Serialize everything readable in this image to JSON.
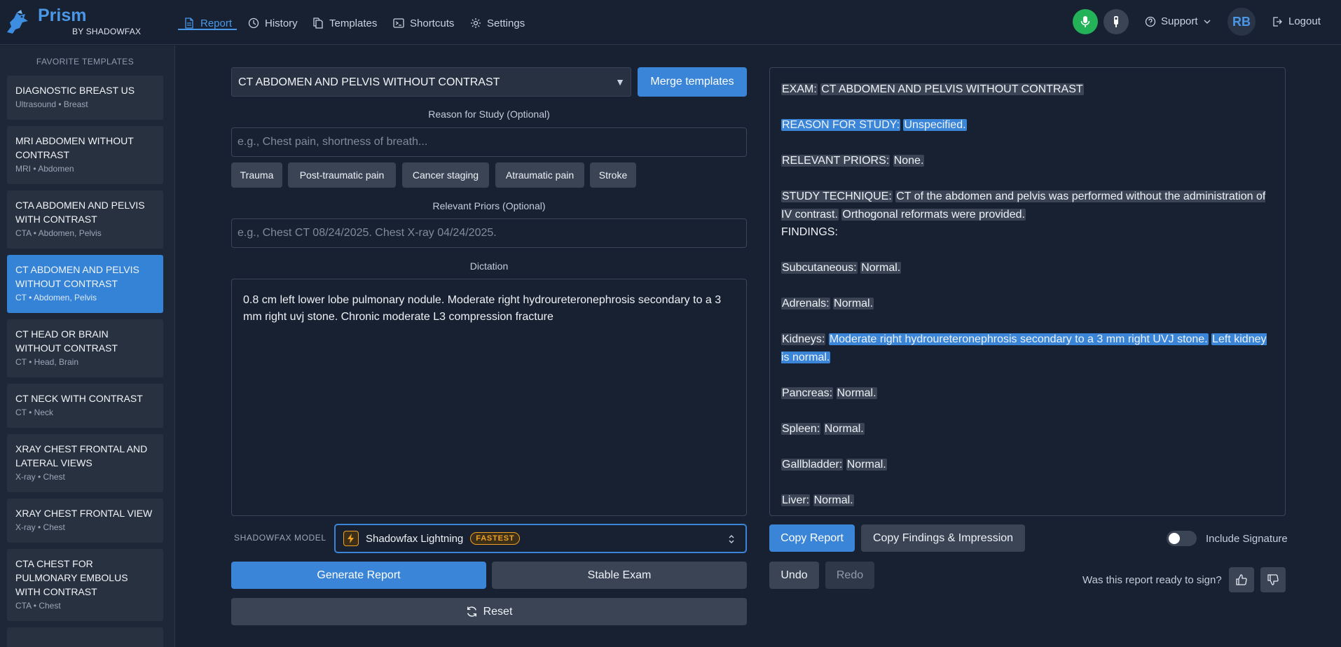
{
  "app": {
    "title": "Prism",
    "subtitle": "BY SHADOWFAX",
    "initials": "RB"
  },
  "nav": {
    "items": [
      {
        "label": "Report",
        "icon": "document-icon",
        "active": true
      },
      {
        "label": "History",
        "icon": "clock-icon"
      },
      {
        "label": "Templates",
        "icon": "copy-icon"
      },
      {
        "label": "Shortcuts",
        "icon": "terminal-icon"
      },
      {
        "label": "Settings",
        "icon": "gear-icon"
      }
    ],
    "support": "Support",
    "logout": "Logout"
  },
  "sidebar": {
    "heading": "FAVORITE TEMPLATES",
    "templates": [
      {
        "title": "DIAGNOSTIC BREAST US",
        "sub": "Ultrasound • Breast"
      },
      {
        "title": "MRI ABDOMEN WITHOUT CONTRAST",
        "sub": "MRI • Abdomen"
      },
      {
        "title": "CTA ABDOMEN AND PELVIS WITH CONTRAST",
        "sub": "CTA • Abdomen, Pelvis"
      },
      {
        "title": "CT ABDOMEN AND PELVIS WITHOUT CONTRAST",
        "sub": "CT • Abdomen, Pelvis",
        "active": true
      },
      {
        "title": "CT HEAD OR BRAIN WITHOUT CONTRAST",
        "sub": "CT • Head, Brain"
      },
      {
        "title": "CT NECK WITH CONTRAST",
        "sub": "CT • Neck"
      },
      {
        "title": "XRAY CHEST FRONTAL AND LATERAL VIEWS",
        "sub": "X-ray • Chest"
      },
      {
        "title": "XRAY CHEST FRONTAL VIEW",
        "sub": "X-ray • Chest"
      },
      {
        "title": "CTA CHEST FOR PULMONARY EMBOLUS WITH CONTRAST",
        "sub": "CTA • Chest"
      }
    ]
  },
  "form": {
    "selected_template": "CT ABDOMEN AND PELVIS WITHOUT CONTRAST",
    "merge_button": "Merge templates",
    "reason_label": "Reason for Study (Optional)",
    "reason_placeholder": "e.g., Chest pain, shortness of breath...",
    "chips": [
      "Trauma",
      "Post-traumatic pain",
      "Cancer staging",
      "Atraumatic pain",
      "Stroke"
    ],
    "priors_label": "Relevant Priors (Optional)",
    "priors_placeholder": "e.g., Chest CT 08/24/2025. Chest X-ray 04/24/2025.",
    "dictation_label": "Dictation",
    "dictation_text": "0.8 cm left lower lobe pulmonary nodule. Moderate right hydroureteronephrosis secondary to a 3 mm right uvj stone. Chronic moderate L3 compression fracture",
    "model_label": "SHADOWFAX MODEL",
    "model_name": "Shadowfax Lightning",
    "model_badge": "FASTEST",
    "generate": "Generate Report",
    "stable": "Stable Exam",
    "reset": "Reset"
  },
  "report": {
    "exam_label": "EXAM:",
    "exam_value": "CT ABDOMEN AND PELVIS WITHOUT CONTRAST",
    "reason_label": "REASON FOR STUDY:",
    "reason_value": "Unspecified.",
    "priors_label": "RELEVANT PRIORS:",
    "priors_value": "None.",
    "technique_label": "STUDY TECHNIQUE:",
    "technique_s1": "CT of the abdomen and pelvis was performed without the administration of IV contrast.",
    "technique_s2": "Orthogonal reformats were provided.",
    "findings_label": "FINDINGS:",
    "subcutaneous_label": "Subcutaneous:",
    "subcutaneous_value": "Normal.",
    "adrenals_label": "Adrenals:",
    "adrenals_value": "Normal.",
    "kidneys_label": "Kidneys:",
    "kidneys_s1": "Moderate right hydroureteronephrosis secondary to a 3 mm right UVJ stone.",
    "kidneys_s2": "Left kidney is normal.",
    "pancreas_label": "Pancreas:",
    "pancreas_value": "Normal.",
    "spleen_label": "Spleen:",
    "spleen_value": "Normal.",
    "gallbladder_label": "Gallbladder:",
    "gallbladder_value": "Normal.",
    "liver_label": "Liver:",
    "liver_value": "Normal.",
    "copy_report": "Copy Report",
    "copy_findings": "Copy Findings & Impression",
    "undo": "Undo",
    "redo": "Redo",
    "include_signature": "Include Signature",
    "ready_question": "Was this report ready to sign?"
  },
  "colors": {
    "accent": "#3a85d7",
    "mic": "#23b258",
    "badge": "#f0a020",
    "background": "#182131"
  }
}
